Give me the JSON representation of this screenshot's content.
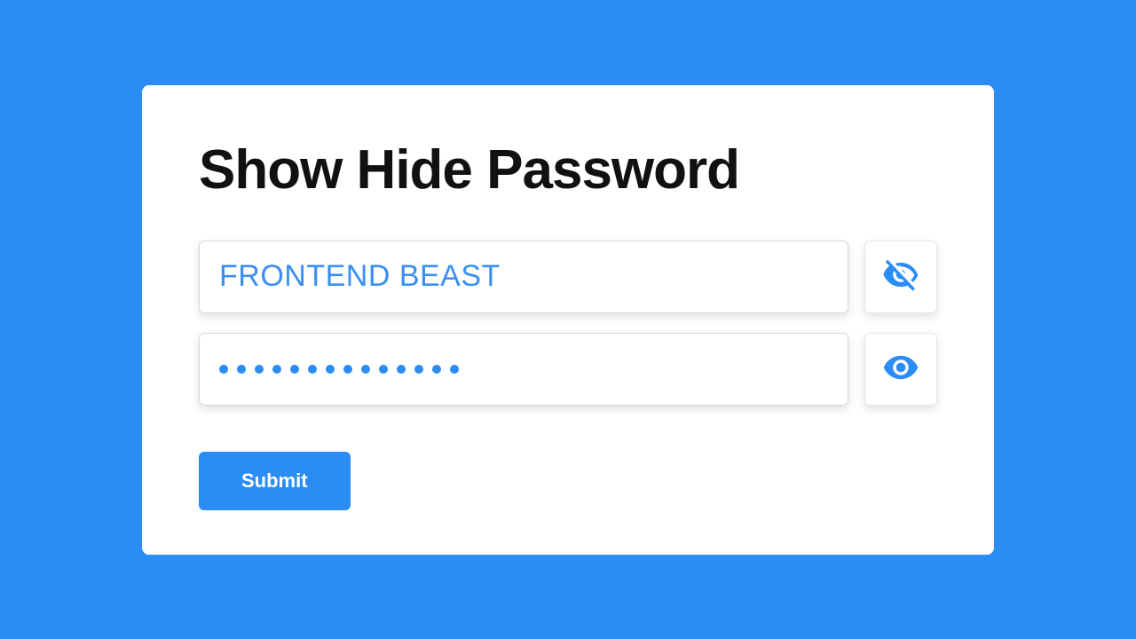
{
  "title": "Show Hide Password",
  "fields": {
    "text_value": "FRONTEND BEAST",
    "password_dot_count": 14
  },
  "buttons": {
    "submit_label": "Submit"
  },
  "icons": {
    "hide": "eye-slash-icon",
    "show": "eye-icon"
  },
  "colors": {
    "accent": "#2b8cf4",
    "background": "#2b8cf4",
    "card": "#ffffff",
    "text_accent": "#3b8ff2"
  }
}
